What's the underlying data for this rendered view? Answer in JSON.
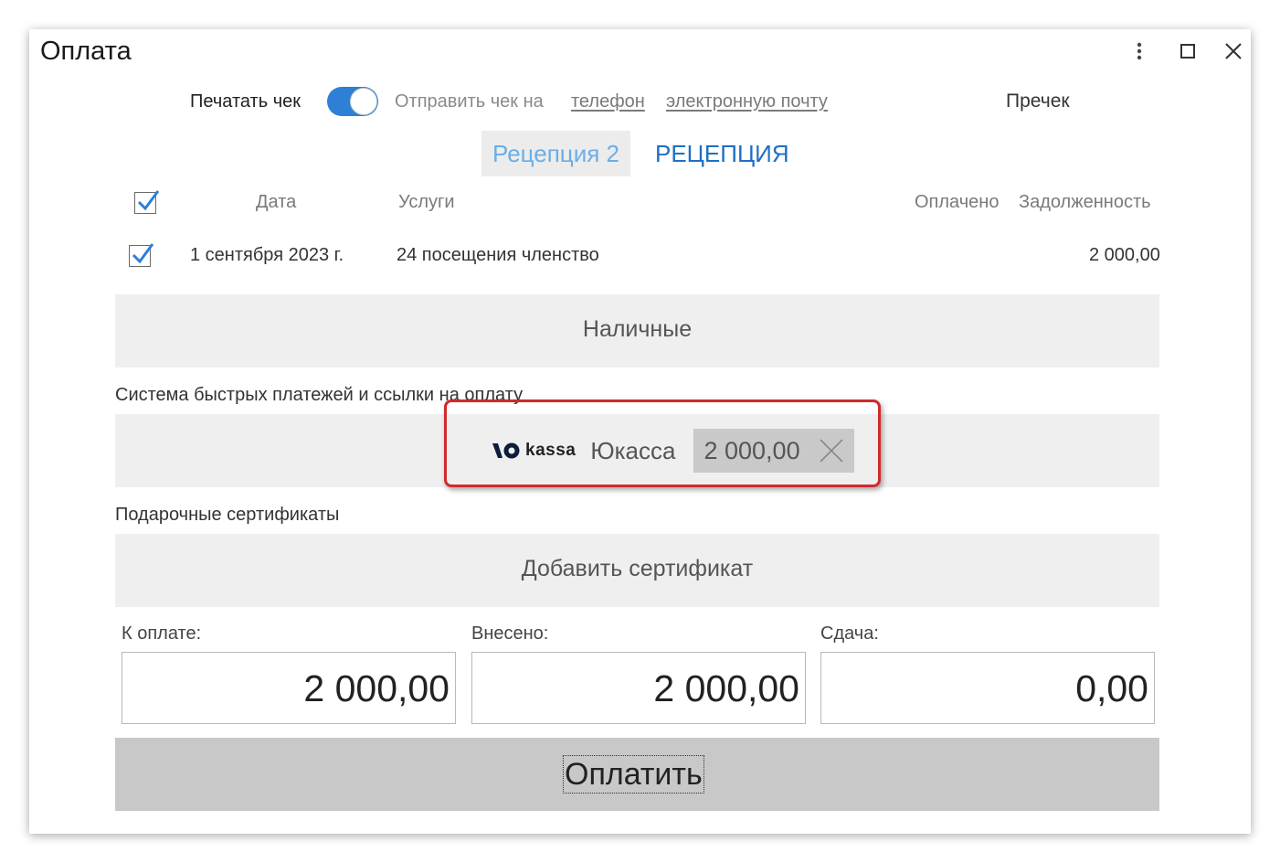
{
  "window": {
    "title": "Оплата",
    "controls": [
      "more-icon",
      "maximize-icon",
      "close-icon"
    ]
  },
  "receipt": {
    "print_label": "Печатать чек",
    "print_enabled": true,
    "send_label": "Отправить чек на",
    "phone_link": "телефон",
    "email_link": "электронную почту",
    "precheck": "Пречек"
  },
  "tabs": [
    {
      "label": "Рецепция 2",
      "active": true
    },
    {
      "label": "РЕЦЕПЦИЯ",
      "active": false
    }
  ],
  "table": {
    "headers": {
      "date": "Дата",
      "services": "Услуги",
      "paid": "Оплачено",
      "debt": "Задолженность"
    },
    "header_checked": true,
    "rows": [
      {
        "checked": true,
        "date": "1 сентября 2023 г.",
        "service": "24 посещения членство",
        "paid": "",
        "debt": "2 000,00"
      }
    ]
  },
  "cash": {
    "label": "Наличные"
  },
  "fast_payments": {
    "section_label": "Система быстрых платежей и ссылки на оплату",
    "item": {
      "logo_text": "kassa",
      "name": "Юкасса",
      "amount": "2 000,00"
    }
  },
  "certificates": {
    "section_label": "Подарочные сертификаты",
    "add_label": "Добавить сертификат"
  },
  "totals": {
    "to_pay_label": "К оплате:",
    "to_pay": "2 000,00",
    "paid_label": "Внесено:",
    "paid": "2 000,00",
    "change_label": "Сдача:",
    "change": "0,00"
  },
  "pay_button": "Оплатить",
  "colors": {
    "accent": "#2e7fd6",
    "tab_active_text": "#6aaee8",
    "tab_inactive_text": "#1f6fc4",
    "highlight": "#d02a2a",
    "block_bg": "#efefef",
    "pay_button_bg": "#c8c8c8"
  }
}
